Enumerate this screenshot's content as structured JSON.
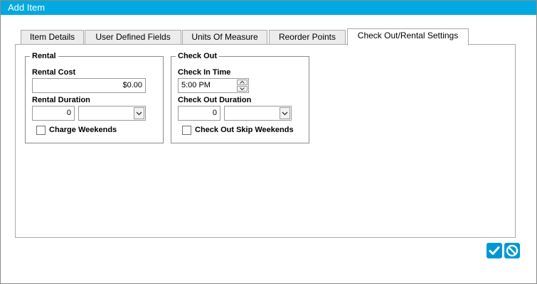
{
  "window": {
    "title": "Add Item"
  },
  "tabs": [
    {
      "label": "Item Details",
      "active": false
    },
    {
      "label": "User Defined Fields",
      "active": false
    },
    {
      "label": "Units Of Measure",
      "active": false
    },
    {
      "label": "Reorder Points",
      "active": false
    },
    {
      "label": "Check Out/Rental Settings",
      "active": true
    }
  ],
  "rental": {
    "group_title": "Rental",
    "cost_label": "Rental Cost",
    "cost_value": "$0.00",
    "duration_label": "Rental Duration",
    "duration_value": "0",
    "duration_unit": "",
    "charge_weekends_label": "Charge Weekends",
    "charge_weekends_checked": false
  },
  "checkout": {
    "group_title": "Check Out",
    "check_in_time_label": "Check In Time",
    "check_in_time_value": "5:00 PM",
    "duration_label": "Check Out Duration",
    "duration_value": "0",
    "duration_unit": "",
    "skip_weekends_label": "Check Out Skip Weekends",
    "skip_weekends_checked": false
  },
  "actions": {
    "ok_icon": "checkmark-icon",
    "cancel_icon": "cancel-icon"
  },
  "colors": {
    "titlebar": "#00a9e0",
    "action_button": "#0098d4"
  }
}
